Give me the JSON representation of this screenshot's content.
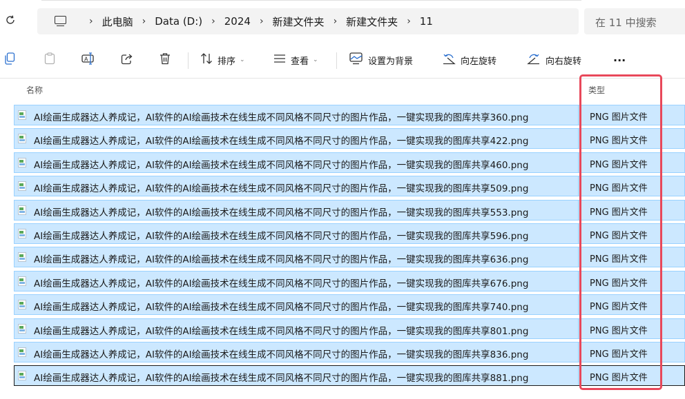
{
  "address_bar": {
    "refresh_icon": "refresh-icon",
    "computer_icon": "computer-icon",
    "breadcrumbs": [
      "此电脑",
      "Data (D:)",
      "2024",
      "新建文件夹",
      "新建文件夹",
      "11"
    ],
    "separator": "›",
    "search_placeholder": "在 11 中搜索"
  },
  "toolbar": {
    "copy_icon": "copy-icon",
    "paste_icon": "paste-icon",
    "rename_icon": "rename-icon",
    "share_icon": "share-icon",
    "delete_icon": "delete-icon",
    "sort_label": "排序",
    "view_label": "查看",
    "set_background_label": "设置为背景",
    "rotate_left_label": "向左旋转",
    "rotate_right_label": "向右旋转",
    "more_label": "···"
  },
  "columns": {
    "name": "名称",
    "type": "类型"
  },
  "files": [
    {
      "name": "AI绘画生成器达人养成记，AI软件的AI绘画技术在线生成不同风格不同尺寸的图片作品，一键实现我的图库共享360.png",
      "type": "PNG 图片文件"
    },
    {
      "name": "AI绘画生成器达人养成记，AI软件的AI绘画技术在线生成不同风格不同尺寸的图片作品，一键实现我的图库共享422.png",
      "type": "PNG 图片文件"
    },
    {
      "name": "AI绘画生成器达人养成记，AI软件的AI绘画技术在线生成不同风格不同尺寸的图片作品，一键实现我的图库共享460.png",
      "type": "PNG 图片文件"
    },
    {
      "name": "AI绘画生成器达人养成记，AI软件的AI绘画技术在线生成不同风格不同尺寸的图片作品，一键实现我的图库共享509.png",
      "type": "PNG 图片文件"
    },
    {
      "name": "AI绘画生成器达人养成记，AI软件的AI绘画技术在线生成不同风格不同尺寸的图片作品，一键实现我的图库共享553.png",
      "type": "PNG 图片文件"
    },
    {
      "name": "AI绘画生成器达人养成记，AI软件的AI绘画技术在线生成不同风格不同尺寸的图片作品，一键实现我的图库共享596.png",
      "type": "PNG 图片文件"
    },
    {
      "name": "AI绘画生成器达人养成记，AI软件的AI绘画技术在线生成不同风格不同尺寸的图片作品，一键实现我的图库共享636.png",
      "type": "PNG 图片文件"
    },
    {
      "name": "AI绘画生成器达人养成记，AI软件的AI绘画技术在线生成不同风格不同尺寸的图片作品，一键实现我的图库共享676.png",
      "type": "PNG 图片文件"
    },
    {
      "name": "AI绘画生成器达人养成记，AI软件的AI绘画技术在线生成不同风格不同尺寸的图片作品，一键实现我的图库共享740.png",
      "type": "PNG 图片文件"
    },
    {
      "name": "AI绘画生成器达人养成记，AI软件的AI绘画技术在线生成不同风格不同尺寸的图片作品，一键实现我的图库共享801.png",
      "type": "PNG 图片文件"
    },
    {
      "name": "AI绘画生成器达人养成记，AI软件的AI绘画技术在线生成不同风格不同尺寸的图片作品，一键实现我的图库共享836.png",
      "type": "PNG 图片文件"
    },
    {
      "name": "AI绘画生成器达人养成记，AI软件的AI绘画技术在线生成不同风格不同尺寸的图片作品，一键实现我的图库共享881.png",
      "type": "PNG 图片文件"
    }
  ],
  "colors": {
    "selection_fill": "#cce8ff",
    "selection_border": "#99d1ff",
    "highlight": "#e8485a"
  }
}
